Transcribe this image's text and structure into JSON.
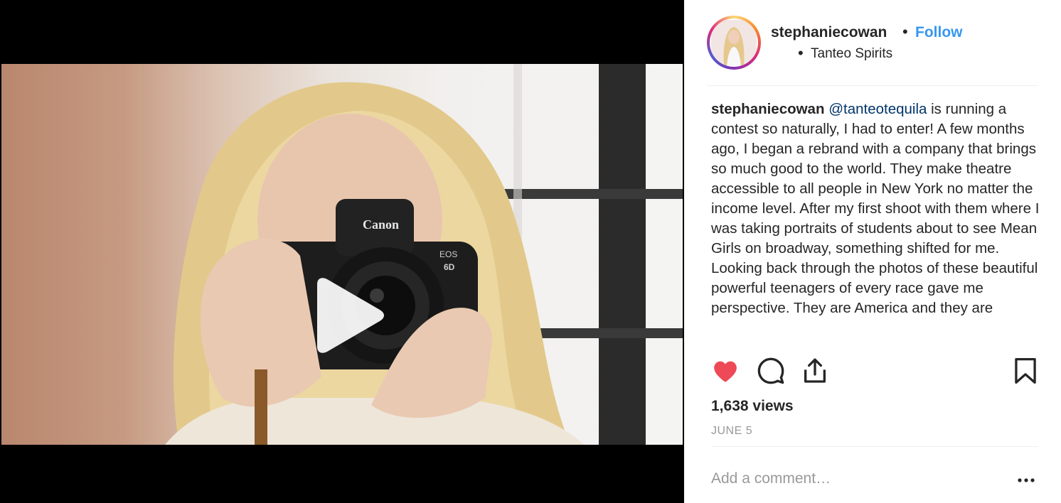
{
  "post": {
    "username": "stephaniecowan",
    "separator": "•",
    "follow_label": "Follow",
    "location_bullet": "•",
    "location": "Tanteo Spirits",
    "caption": {
      "username": "stephaniecowan",
      "mention": "@tanteotequila",
      "text": " is running a contest so naturally, I had to enter! A few months ago, I began a rebrand with a company that brings so much good to the world. They make theatre accessible to all people in New York no matter the income level. After my first shoot with them where I was taking portraits of students about to see Mean Girls on broadway, something shifted for me. Looking back through the photos of these beautiful powerful teenagers of every race gave me perspective. They are America and they are"
    },
    "views": "1,638 views",
    "date": "JUNE 5",
    "comment_placeholder": "Add a comment…",
    "liked": true
  },
  "icons": {
    "like": "heart-icon",
    "comment": "comment-icon",
    "share": "share-icon",
    "save": "bookmark-icon",
    "play": "play-icon",
    "more": "more-options-icon"
  },
  "colors": {
    "follow": "#3897f0",
    "liked_heart": "#ed4956",
    "mention": "#003569",
    "muted": "#999999"
  },
  "video": {
    "camera_brand": "Canon",
    "camera_model": "EOS",
    "camera_model_number": "6D"
  }
}
